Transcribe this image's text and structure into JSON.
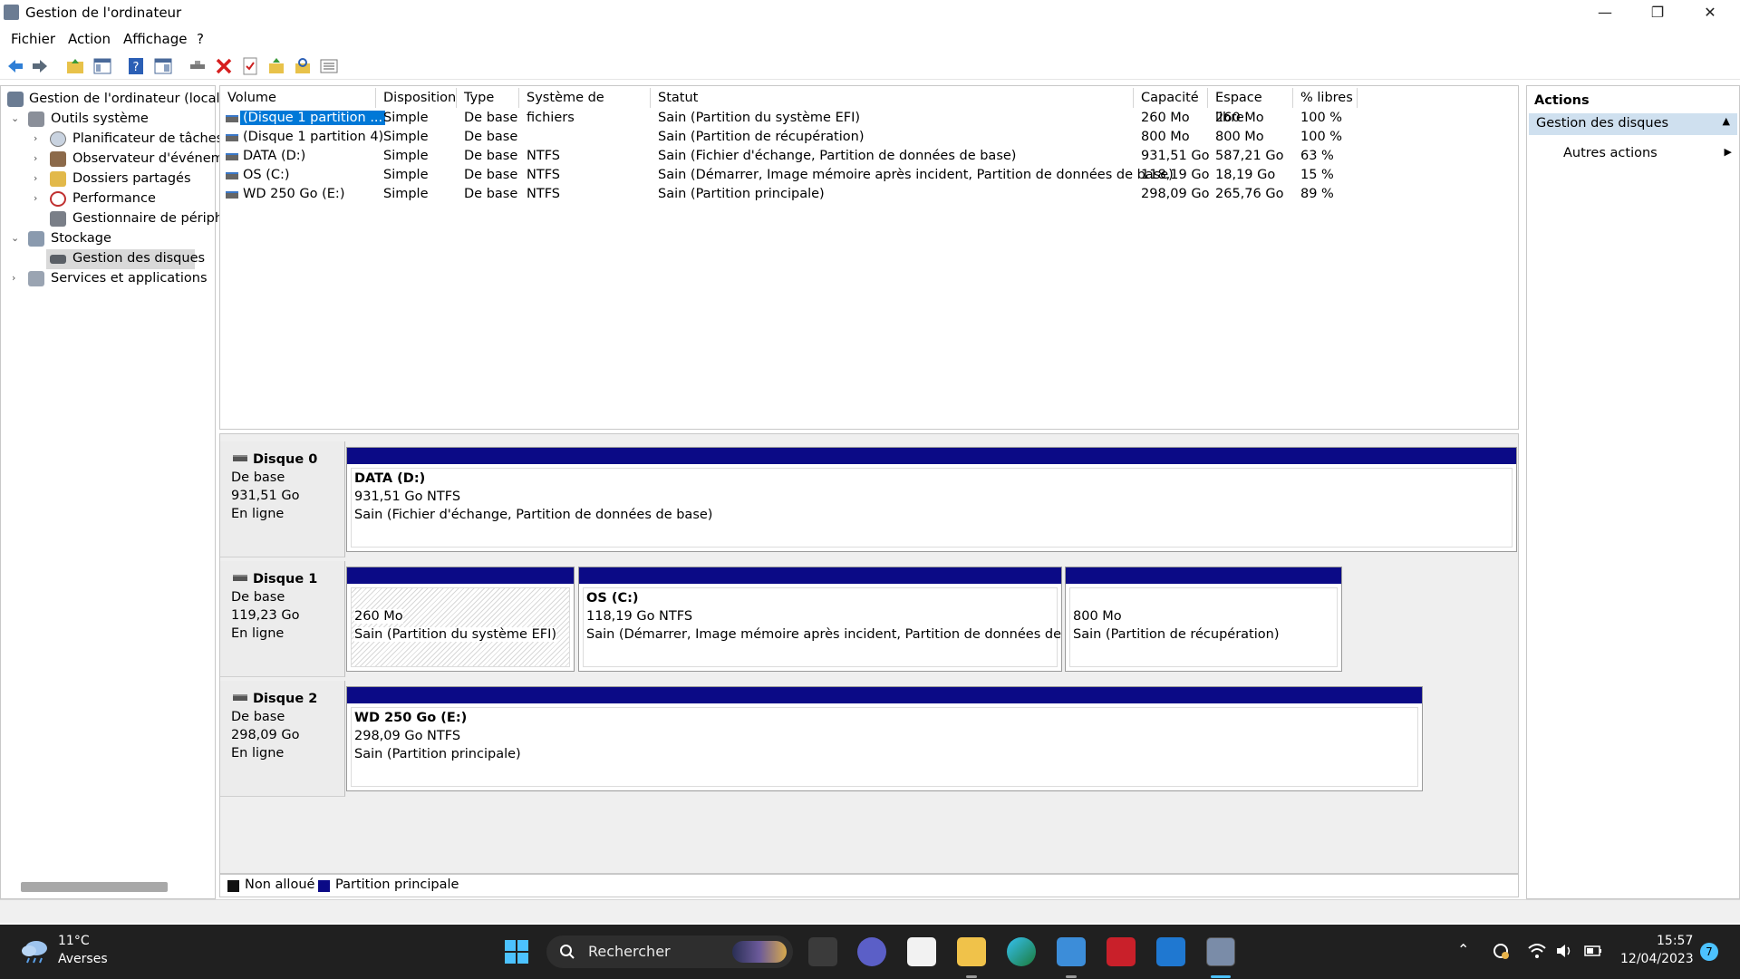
{
  "window": {
    "title": "Gestion de l'ordinateur",
    "minimize": "—",
    "restore": "❐",
    "close": "✕"
  },
  "menu": [
    "Fichier",
    "Action",
    "Affichage",
    "?"
  ],
  "tree": {
    "root": "Gestion de l'ordinateur (local)",
    "outils": "Outils système",
    "planificateur": "Planificateur de tâches",
    "observateur": "Observateur d'événeme",
    "dossiers": "Dossiers partagés",
    "performance": "Performance",
    "gestionnaire": "Gestionnaire de périphé",
    "stockage": "Stockage",
    "gestion_disques": "Gestion des disques",
    "services": "Services et applications"
  },
  "columns": [
    "Volume",
    "Disposition",
    "Type",
    "Système de fichiers",
    "Statut",
    "Capacité",
    "Espace libre",
    "% libres"
  ],
  "rows": [
    {
      "volume": "(Disque 1 partition ...",
      "disposition": "Simple",
      "type": "De base",
      "fs": "",
      "statut": "Sain (Partition du système EFI)",
      "capacite": "260 Mo",
      "libre": "260 Mo",
      "pct": "100 %"
    },
    {
      "volume": "(Disque 1 partition 4)",
      "disposition": "Simple",
      "type": "De base",
      "fs": "",
      "statut": "Sain (Partition de récupération)",
      "capacite": "800 Mo",
      "libre": "800 Mo",
      "pct": "100 %"
    },
    {
      "volume": "DATA (D:)",
      "disposition": "Simple",
      "type": "De base",
      "fs": "NTFS",
      "statut": "Sain (Fichier d'échange, Partition de données de base)",
      "capacite": "931,51 Go",
      "libre": "587,21 Go",
      "pct": "63 %"
    },
    {
      "volume": "OS (C:)",
      "disposition": "Simple",
      "type": "De base",
      "fs": "NTFS",
      "statut": "Sain (Démarrer, Image mémoire après incident, Partition de données de base)",
      "capacite": "118,19 Go",
      "libre": "18,19 Go",
      "pct": "15 %"
    },
    {
      "volume": "WD 250 Go (E:)",
      "disposition": "Simple",
      "type": "De base",
      "fs": "NTFS",
      "statut": "Sain (Partition principale)",
      "capacite": "298,09 Go",
      "libre": "265,76 Go",
      "pct": "89 %"
    }
  ],
  "disks": [
    {
      "name": "Disque 0",
      "kind": "De base",
      "size": "931,51 Go",
      "state": "En ligne",
      "parts": [
        {
          "title": "DATA  (D:)",
          "size": "931,51 Go NTFS",
          "status": "Sain (Fichier d'échange, Partition de données de base)"
        }
      ]
    },
    {
      "name": "Disque 1",
      "kind": "De base",
      "size": "119,23 Go",
      "state": "En ligne",
      "parts": [
        {
          "title": "",
          "size": "260 Mo",
          "status": "Sain (Partition du système EFI)"
        },
        {
          "title": "OS  (C:)",
          "size": "118,19 Go NTFS",
          "status": "Sain (Démarrer, Image mémoire après incident, Partition de données de base)"
        },
        {
          "title": "",
          "size": "800 Mo",
          "status": "Sain (Partition de récupération)"
        }
      ]
    },
    {
      "name": "Disque 2",
      "kind": "De base",
      "size": "298,09 Go",
      "state": "En ligne",
      "parts": [
        {
          "title": "WD 250 Go  (E:)",
          "size": "298,09 Go NTFS",
          "status": "Sain (Partition principale)"
        }
      ]
    }
  ],
  "legend": {
    "unallocated": "Non alloué",
    "primary": "Partition principale"
  },
  "actions": {
    "title": "Actions",
    "group": "Gestion des disques",
    "more": "Autres actions"
  },
  "taskbar": {
    "temp": "11°C",
    "weather": "Averses",
    "search": "Rechercher",
    "time": "15:57",
    "date": "12/04/2023",
    "badge": "7"
  },
  "colors": {
    "partition_bar": "#0b0a86",
    "selection": "#0078d7",
    "taskbar": "#202020"
  }
}
